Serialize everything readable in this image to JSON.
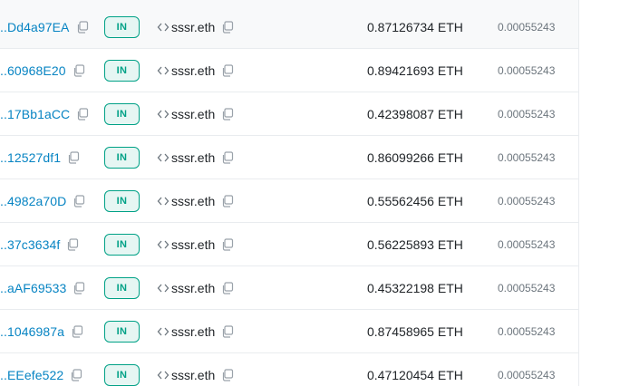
{
  "badge_label": "IN",
  "to_name": "sssr.eth",
  "icons": {
    "copy": "copy-icon",
    "contract": "contract-code-icon"
  },
  "colors": {
    "link": "#0784c3",
    "badge_text": "#00a186",
    "badge_bg": "#e6f6f3",
    "muted": "#6c757d"
  },
  "rows": [
    {
      "from": "..Dd4a97EA",
      "amount": "0.87126734 ETH",
      "fee": "0.00055243"
    },
    {
      "from": "..60968E20",
      "amount": "0.89421693 ETH",
      "fee": "0.00055243"
    },
    {
      "from": "..17Bb1aCC",
      "amount": "0.42398087 ETH",
      "fee": "0.00055243"
    },
    {
      "from": "..12527df1",
      "amount": "0.86099266 ETH",
      "fee": "0.00055243"
    },
    {
      "from": "..4982a70D",
      "amount": "0.55562456 ETH",
      "fee": "0.00055243"
    },
    {
      "from": "..37c3634f",
      "amount": "0.56225893 ETH",
      "fee": "0.00055243"
    },
    {
      "from": "..aAF69533",
      "amount": "0.45322198 ETH",
      "fee": "0.00055243"
    },
    {
      "from": "..1046987a",
      "amount": "0.87458965 ETH",
      "fee": "0.00055243"
    },
    {
      "from": "..EEefe522",
      "amount": "0.47120454 ETH",
      "fee": "0.00055243"
    }
  ]
}
